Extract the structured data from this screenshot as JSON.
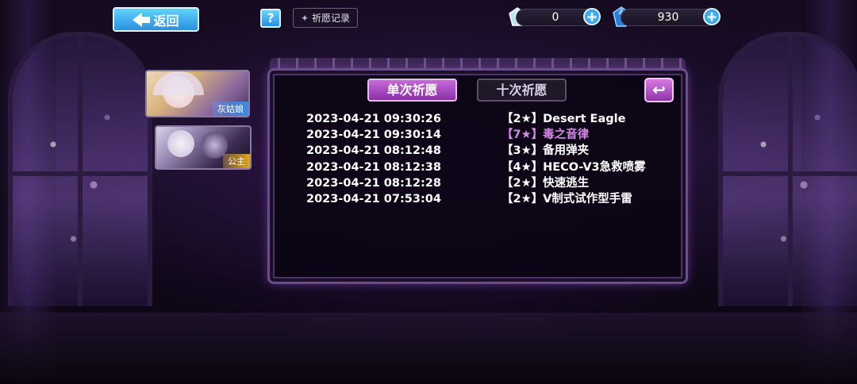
{
  "header": {
    "back_label": "返回",
    "help_label": "?",
    "record_label": "祈愿记录",
    "currency1": {
      "icon": "crystal-icon",
      "value": "0"
    },
    "currency2": {
      "icon": "blue-gem-icon",
      "value": "930"
    },
    "plus_label": "+"
  },
  "characters": [
    {
      "tag": "灰姑娘"
    },
    {
      "tag": "公主"
    }
  ],
  "tabs": {
    "single": "单次祈愿",
    "ten": "十次祈愿",
    "active": "single"
  },
  "return_icon": "return-arrow-icon",
  "records": [
    {
      "time": "2023-04-21 09:30:26",
      "item": "【2★】Desert Eagle",
      "highlight": false
    },
    {
      "time": "2023-04-21 09:30:14",
      "item": "【7★】毒之音律",
      "highlight": true
    },
    {
      "time": "2023-04-21 08:12:48",
      "item": "【3★】备用弹夹",
      "highlight": false
    },
    {
      "time": "2023-04-21 08:12:38",
      "item": "【4★】HECO-V3急救喷雾",
      "highlight": false
    },
    {
      "time": "2023-04-21 08:12:28",
      "item": "【2★】快速逃生",
      "highlight": false
    },
    {
      "time": "2023-04-21 07:53:04",
      "item": "【2★】V制式试作型手雷",
      "highlight": false
    }
  ],
  "colors": {
    "accent_purple": "#c76ad8",
    "highlight_text": "#d48ae6",
    "button_blue": "#2b8fe0"
  }
}
